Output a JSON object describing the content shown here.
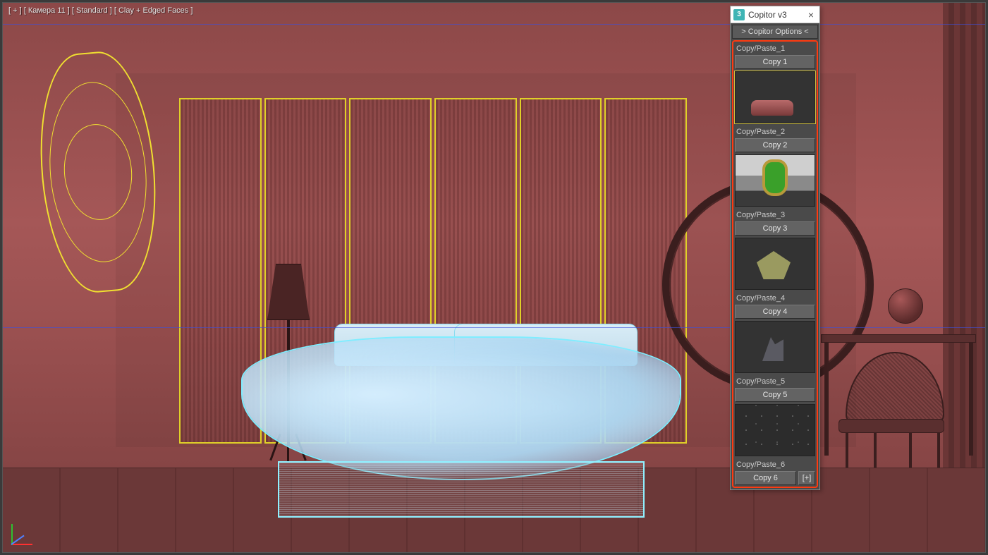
{
  "viewport": {
    "label": "[ + ] [ Камера 11 ] [ Standard ] [ Clay + Edged Faces ]"
  },
  "copitor": {
    "window_title": "Copitor v3",
    "close_glyph": "×",
    "app_badge": "3",
    "options_label": "> Copitor Options <",
    "add_slot_label": "[+]",
    "slots": [
      {
        "label": "Copy/Paste_1",
        "button": "Copy 1"
      },
      {
        "label": "Copy/Paste_2",
        "button": "Copy 2"
      },
      {
        "label": "Copy/Paste_3",
        "button": "Copy 3"
      },
      {
        "label": "Copy/Paste_4",
        "button": "Copy 4"
      },
      {
        "label": "Copy/Paste_5",
        "button": "Copy 5"
      },
      {
        "label": "Copy/Paste_6",
        "button": "Copy 6"
      }
    ]
  }
}
